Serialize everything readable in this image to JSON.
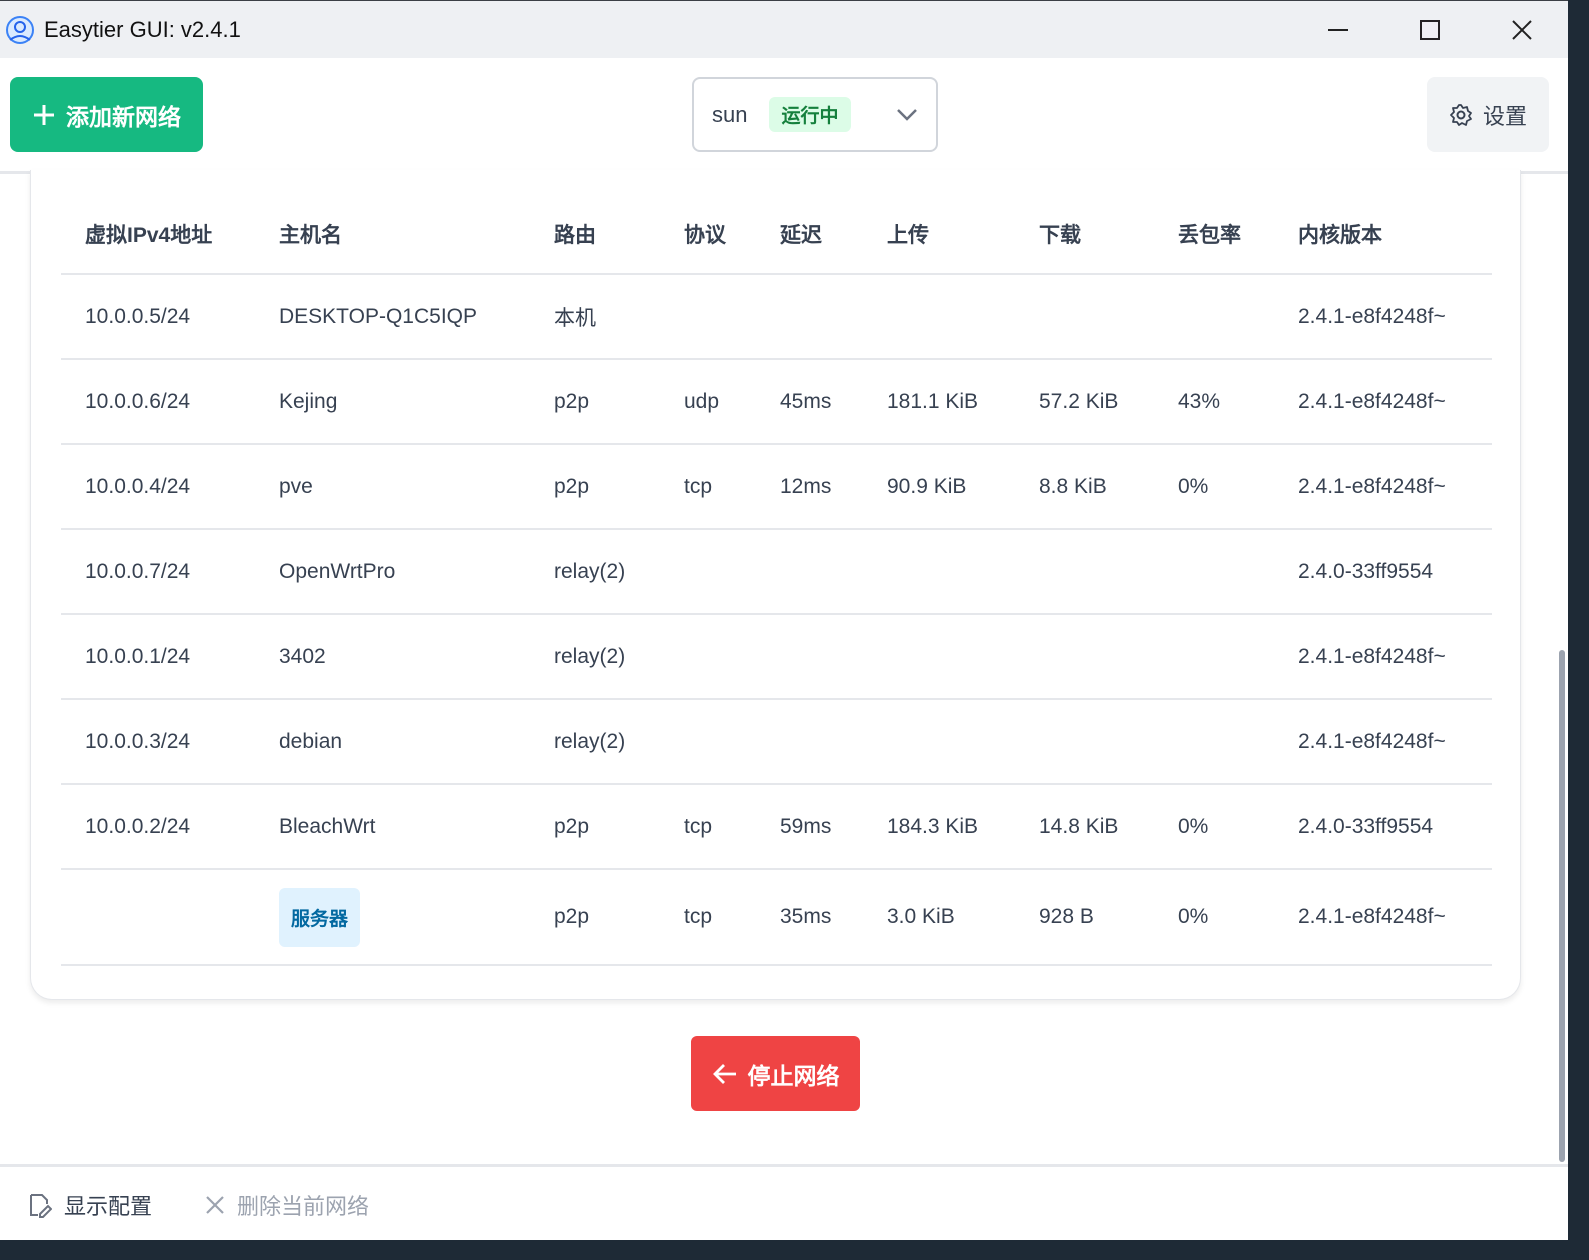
{
  "window": {
    "title": "Easytier GUI: v2.4.1",
    "minimize_icon": "minimize-icon",
    "maximize_icon": "maximize-icon",
    "close_icon": "close-icon"
  },
  "toolbar": {
    "add_label": "添加新网络",
    "network_name": "sun",
    "network_status": "运行中",
    "settings_label": "设置"
  },
  "table": {
    "headers": [
      "虚拟IPv4地址",
      "主机名",
      "路由",
      "协议",
      "延迟",
      "上传",
      "下载",
      "丢包率",
      "内核版本"
    ],
    "rows": [
      {
        "ip": "10.0.0.5/24",
        "host": "DESKTOP-Q1C5IQP",
        "route": "本机",
        "proto": "",
        "latency": "",
        "up": "",
        "down": "",
        "loss": "",
        "version": "2.4.1-e8f4248f~"
      },
      {
        "ip": "10.0.0.6/24",
        "host": "Kejing",
        "route": "p2p",
        "proto": "udp",
        "latency": "45ms",
        "up": "181.1 KiB",
        "down": "57.2 KiB",
        "loss": "43%",
        "version": "2.4.1-e8f4248f~"
      },
      {
        "ip": "10.0.0.4/24",
        "host": "pve",
        "route": "p2p",
        "proto": "tcp",
        "latency": "12ms",
        "up": "90.9 KiB",
        "down": "8.8 KiB",
        "loss": "0%",
        "version": "2.4.1-e8f4248f~"
      },
      {
        "ip": "10.0.0.7/24",
        "host": "OpenWrtPro",
        "route": "relay(2)",
        "proto": "",
        "latency": "",
        "up": "",
        "down": "",
        "loss": "",
        "version": "2.4.0-33ff9554"
      },
      {
        "ip": "10.0.0.1/24",
        "host": "3402",
        "route": "relay(2)",
        "proto": "",
        "latency": "",
        "up": "",
        "down": "",
        "loss": "",
        "version": "2.4.1-e8f4248f~"
      },
      {
        "ip": "10.0.0.3/24",
        "host": "debian",
        "route": "relay(2)",
        "proto": "",
        "latency": "",
        "up": "",
        "down": "",
        "loss": "",
        "version": "2.4.1-e8f4248f~"
      },
      {
        "ip": "10.0.0.2/24",
        "host": "BleachWrt",
        "route": "p2p",
        "proto": "tcp",
        "latency": "59ms",
        "up": "184.3 KiB",
        "down": "14.8 KiB",
        "loss": "0%",
        "version": "2.4.0-33ff9554"
      },
      {
        "ip": "",
        "host": "服务器",
        "route": "p2p",
        "proto": "tcp",
        "latency": "35ms",
        "up": "3.0 KiB",
        "down": "928 B",
        "loss": "0%",
        "version": "2.4.1-e8f4248f~",
        "host_is_tag": true
      }
    ]
  },
  "actions": {
    "stop_label": "停止网络"
  },
  "bottombar": {
    "show_config": "显示配置",
    "delete_network": "删除当前网络"
  },
  "colors": {
    "primary_green": "#16b981",
    "danger_red": "#ef4444",
    "status_green_bg": "#dcfce7",
    "status_green_text": "#15803d",
    "server_tag_bg": "#e0f2fe",
    "server_tag_text": "#0369a1"
  }
}
